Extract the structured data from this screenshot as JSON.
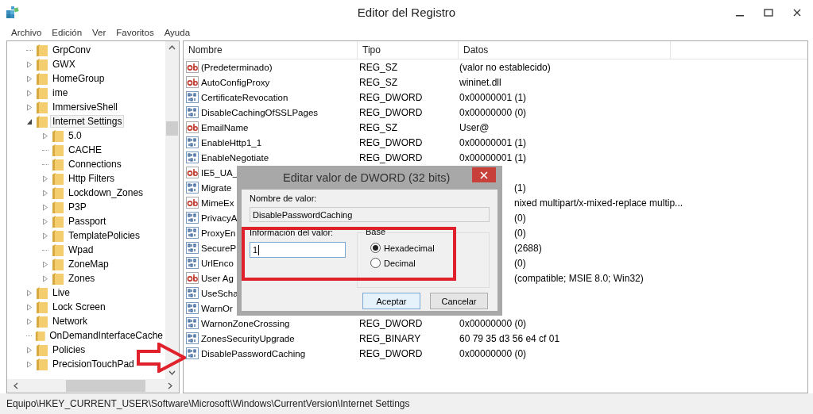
{
  "window": {
    "title": "Editor del Registro"
  },
  "menu": [
    "Archivo",
    "Edición",
    "Ver",
    "Favoritos",
    "Ayuda"
  ],
  "tree": [
    {
      "label": "GrpConv",
      "expandable": false,
      "selected": false
    },
    {
      "label": "GWX",
      "expandable": true,
      "selected": false
    },
    {
      "label": "HomeGroup",
      "expandable": true,
      "selected": false
    },
    {
      "label": "ime",
      "expandable": true,
      "selected": false
    },
    {
      "label": "ImmersiveShell",
      "expandable": true,
      "selected": false
    },
    {
      "label": "Internet Settings",
      "expandable": true,
      "selected": true,
      "children": [
        {
          "label": "5.0",
          "expandable": true,
          "selected": false
        },
        {
          "label": "CACHE",
          "expandable": false,
          "selected": false
        },
        {
          "label": "Connections",
          "expandable": false,
          "selected": false
        },
        {
          "label": "Http Filters",
          "expandable": true,
          "selected": false
        },
        {
          "label": "Lockdown_Zones",
          "expandable": true,
          "selected": false
        },
        {
          "label": "P3P",
          "expandable": true,
          "selected": false
        },
        {
          "label": "Passport",
          "expandable": true,
          "selected": false
        },
        {
          "label": "TemplatePolicies",
          "expandable": true,
          "selected": false
        },
        {
          "label": "Wpad",
          "expandable": false,
          "selected": false
        },
        {
          "label": "ZoneMap",
          "expandable": true,
          "selected": false
        },
        {
          "label": "Zones",
          "expandable": true,
          "selected": false
        }
      ]
    },
    {
      "label": "Live",
      "expandable": true,
      "selected": false
    },
    {
      "label": "Lock Screen",
      "expandable": true,
      "selected": false
    },
    {
      "label": "Network",
      "expandable": true,
      "selected": false
    },
    {
      "label": "OnDemandInterfaceCache",
      "expandable": false,
      "selected": false
    },
    {
      "label": "Policies",
      "expandable": true,
      "selected": false
    },
    {
      "label": "PrecisionTouchPad",
      "expandable": true,
      "selected": false
    }
  ],
  "table": {
    "columns": [
      "Nombre",
      "Tipo",
      "Datos"
    ],
    "rows": [
      {
        "kind": "string",
        "name": "(Predeterminado)",
        "type": "REG_SZ",
        "data": "(valor no establecido)"
      },
      {
        "kind": "string",
        "name": "AutoConfigProxy",
        "type": "REG_SZ",
        "data": "wininet.dll"
      },
      {
        "kind": "binary",
        "name": "CertificateRevocation",
        "type": "REG_DWORD",
        "data": "0x00000001 (1)"
      },
      {
        "kind": "binary",
        "name": "DisableCachingOfSSLPages",
        "type": "REG_DWORD",
        "data": "0x00000000 (0)"
      },
      {
        "kind": "string",
        "name": "EmailName",
        "type": "REG_SZ",
        "data": "User@"
      },
      {
        "kind": "binary",
        "name": "EnableHttp1_1",
        "type": "REG_DWORD",
        "data": "0x00000001 (1)"
      },
      {
        "kind": "binary",
        "name": "EnableNegotiate",
        "type": "REG_DWORD",
        "data": "0x00000001 (1)"
      },
      {
        "kind": "string",
        "name": "IE5_UA_"
      },
      {
        "kind": "binary",
        "name": "Migrate",
        "data": "(1)"
      },
      {
        "kind": "string",
        "name": "MimeEx",
        "data": "nixed multipart/x-mixed-replace multip..."
      },
      {
        "kind": "binary",
        "name": "PrivacyA",
        "data": "(0)"
      },
      {
        "kind": "binary",
        "name": "ProxyEn",
        "data": "(0)"
      },
      {
        "kind": "binary",
        "name": "SecureP",
        "data": "(2688)"
      },
      {
        "kind": "binary",
        "name": "UrlEnco",
        "data": "(0)"
      },
      {
        "kind": "string",
        "name": "User Ag",
        "data": "(compatible; MSIE 8.0; Win32)"
      },
      {
        "kind": "binary",
        "name": "UseScha"
      },
      {
        "kind": "binary",
        "name": "WarnOr"
      },
      {
        "kind": "binary",
        "name": "WarnonZoneCrossing",
        "type": "REG_DWORD",
        "data": "0x00000000 (0)"
      },
      {
        "kind": "binary",
        "name": "ZonesSecurityUpgrade",
        "type": "REG_BINARY",
        "data": "60 79 35 d3 56 e4 cf 01"
      },
      {
        "kind": "binary",
        "name": "DisablePasswordCaching",
        "type": "REG_DWORD",
        "data": "0x00000000 (0)"
      }
    ]
  },
  "dialog": {
    "title": "Editar valor de DWORD (32 bits)",
    "name_label": "Nombre de valor:",
    "name_value": "DisablePasswordCaching",
    "data_label": "Información del valor:",
    "data_value": "1",
    "base_label": "Base",
    "bases": [
      {
        "label": "Hexadecimal",
        "selected": true
      },
      {
        "label": "Decimal",
        "selected": false
      }
    ],
    "buttons": [
      "Aceptar",
      "Cancelar"
    ]
  },
  "status_bar": "Equipo\\HKEY_CURRENT_USER\\Software\\Microsoft\\Windows\\CurrentVersion\\Internet Settings"
}
